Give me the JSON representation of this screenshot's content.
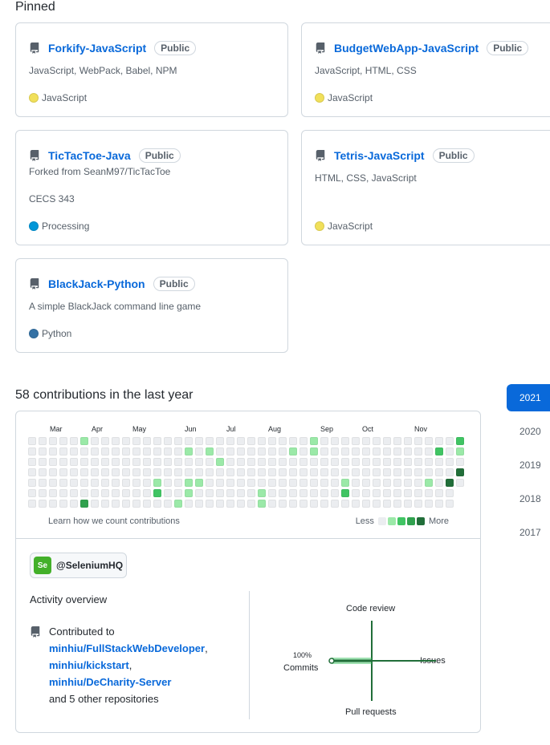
{
  "pinned": {
    "title": "Pinned",
    "cards": [
      {
        "name": "Forkify-JavaScript",
        "badge": "Public",
        "desc": "JavaScript, WebPack, Babel, NPM",
        "desc2": "",
        "lang": "JavaScript",
        "lang_color": "#f1e05a"
      },
      {
        "name": "BudgetWebApp-JavaScript",
        "badge": "Public",
        "desc": "JavaScript, HTML, CSS",
        "desc2": "",
        "lang": "JavaScript",
        "lang_color": "#f1e05a"
      },
      {
        "name": "TicTacToe-Java",
        "badge": "Public",
        "desc": "Forked from SeanM97/TicTacToe",
        "desc2": "CECS 343",
        "lang": "Processing",
        "lang_color": "#0096D8"
      },
      {
        "name": "Tetris-JavaScript",
        "badge": "Public",
        "desc": "HTML, CSS, JavaScript",
        "desc2": "",
        "lang": "JavaScript",
        "lang_color": "#f1e05a"
      },
      {
        "name": "BlackJack-Python",
        "badge": "Public",
        "desc": "A simple BlackJack command line game",
        "desc2": "",
        "lang": "Python",
        "lang_color": "#3572A5"
      }
    ]
  },
  "contributions": {
    "title": "58 contributions in the last year",
    "months": [
      "Mar",
      "Apr",
      "May",
      "Jun",
      "Jul",
      "Aug",
      "Sep",
      "Oct",
      "Nov"
    ],
    "learn_link": "Learn how we count contributions",
    "legend_less": "Less",
    "legend_more": "More",
    "colors": [
      "#ebedf0",
      "#9be9a8",
      "#40c463",
      "#30a14e",
      "#216e39"
    ],
    "active": [
      {
        "w": 5,
        "d": 0,
        "l": 1
      },
      {
        "w": 5,
        "d": 6,
        "l": 3
      },
      {
        "w": 12,
        "d": 4,
        "l": 1
      },
      {
        "w": 12,
        "d": 5,
        "l": 2
      },
      {
        "w": 14,
        "d": 6,
        "l": 1
      },
      {
        "w": 15,
        "d": 1,
        "l": 1
      },
      {
        "w": 15,
        "d": 4,
        "l": 1
      },
      {
        "w": 15,
        "d": 5,
        "l": 1
      },
      {
        "w": 16,
        "d": 4,
        "l": 1
      },
      {
        "w": 17,
        "d": 1,
        "l": 1
      },
      {
        "w": 18,
        "d": 2,
        "l": 1
      },
      {
        "w": 22,
        "d": 5,
        "l": 1
      },
      {
        "w": 22,
        "d": 6,
        "l": 1
      },
      {
        "w": 25,
        "d": 1,
        "l": 1
      },
      {
        "w": 27,
        "d": 0,
        "l": 1
      },
      {
        "w": 27,
        "d": 1,
        "l": 1
      },
      {
        "w": 30,
        "d": 4,
        "l": 1
      },
      {
        "w": 30,
        "d": 5,
        "l": 2
      },
      {
        "w": 38,
        "d": 4,
        "l": 1
      },
      {
        "w": 39,
        "d": 1,
        "l": 2
      },
      {
        "w": 40,
        "d": 4,
        "l": 4
      },
      {
        "w": 41,
        "d": 0,
        "l": 2
      },
      {
        "w": 41,
        "d": 1,
        "l": 1
      },
      {
        "w": 41,
        "d": 3,
        "l": 4
      }
    ]
  },
  "years": [
    "2021",
    "2020",
    "2019",
    "2018",
    "2017"
  ],
  "activity": {
    "org": "@SeleniumHQ",
    "org_logo": "Se",
    "title": "Activity overview",
    "contributed_to": "Contributed to",
    "repos": [
      "minhiu/FullStackWebDeveloper",
      "minhiu/kickstart",
      "minhiu/DeCharity-Server"
    ],
    "others": "and 5 other repositories",
    "axis": {
      "top": "Code review",
      "right": "Issues",
      "bottom": "Pull requests",
      "left_pct": "100%",
      "left": "Commits"
    },
    "commits_pct": 100,
    "color": "#216e39"
  }
}
